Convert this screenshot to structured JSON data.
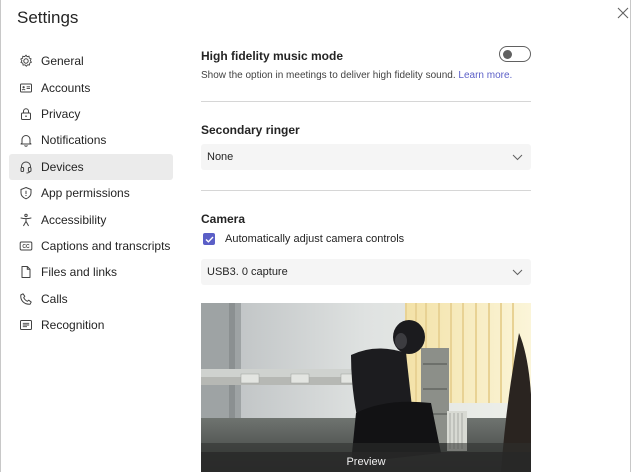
{
  "window": {
    "title": "Settings"
  },
  "sidebar": {
    "items": [
      {
        "label": "General",
        "icon": "gear-icon"
      },
      {
        "label": "Accounts",
        "icon": "id-card-icon"
      },
      {
        "label": "Privacy",
        "icon": "lock-icon"
      },
      {
        "label": "Notifications",
        "icon": "bell-icon"
      },
      {
        "label": "Devices",
        "icon": "headset-icon",
        "active": true
      },
      {
        "label": "App permissions",
        "icon": "shield-icon"
      },
      {
        "label": "Accessibility",
        "icon": "accessibility-icon"
      },
      {
        "label": "Captions and transcripts",
        "icon": "cc-icon"
      },
      {
        "label": "Files and links",
        "icon": "document-icon"
      },
      {
        "label": "Calls",
        "icon": "phone-icon"
      },
      {
        "label": "Recognition",
        "icon": "recognition-icon"
      }
    ]
  },
  "music_mode": {
    "title": "High fidelity music mode",
    "description": "Show the option in meetings to deliver high fidelity sound.",
    "link": "Learn more.",
    "enabled": false
  },
  "secondary_ringer": {
    "title": "Secondary ringer",
    "selected": "None"
  },
  "camera": {
    "title": "Camera",
    "auto_adjust_label": "Automatically adjust camera controls",
    "auto_adjust_checked": true,
    "selected": "USB3. 0 capture",
    "preview_label": "Preview"
  },
  "colors": {
    "accent": "#5b5fc7",
    "active_nav_bg": "#ebebeb",
    "dropdown_bg": "#f5f5f5"
  }
}
